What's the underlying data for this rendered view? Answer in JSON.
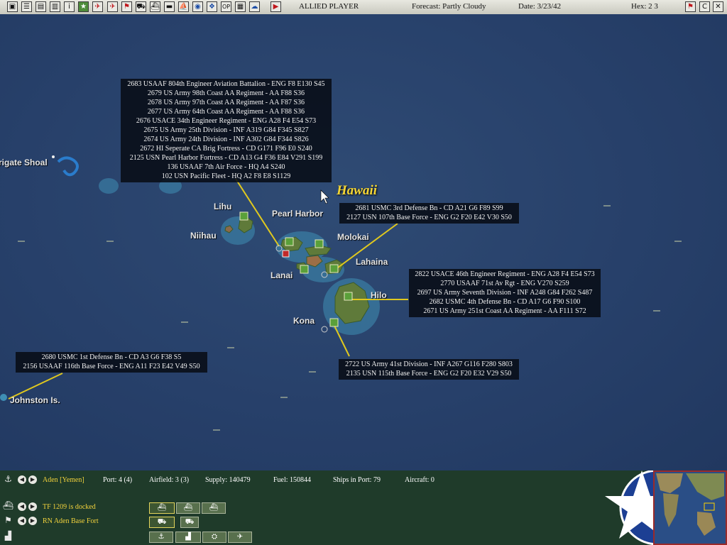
{
  "toolbar": {
    "icons": [
      {
        "name": "save-icon",
        "glyph": "▣"
      },
      {
        "name": "list-icon",
        "glyph": "☰"
      },
      {
        "name": "report-icon",
        "glyph": "▤"
      },
      {
        "name": "filter-icon",
        "glyph": "▥"
      },
      {
        "name": "info-icon",
        "glyph": "i"
      },
      {
        "name": "airfield-toggle-icon",
        "glyph": "★"
      },
      {
        "name": "aircraft-icon",
        "glyph": "✈"
      },
      {
        "name": "naval-aircraft-icon",
        "glyph": "✈"
      },
      {
        "name": "flag-icon",
        "glyph": "⚑"
      },
      {
        "name": "ground-units-icon",
        "glyph": "⛟"
      },
      {
        "name": "ships-icon",
        "glyph": "⛴"
      },
      {
        "name": "sub-icon",
        "glyph": "▬"
      },
      {
        "name": "task-force-icon",
        "glyph": "⛵"
      },
      {
        "name": "globe-icon",
        "glyph": "◉"
      },
      {
        "name": "terrain-icon",
        "glyph": "❖"
      },
      {
        "name": "ops-button-icon",
        "glyph": "OP"
      },
      {
        "name": "screen-icon",
        "glyph": "▦"
      },
      {
        "name": "weather-icon",
        "glyph": "☁"
      },
      {
        "name": "end-turn-icon",
        "glyph": "▶"
      }
    ],
    "player": "ALLIED PLAYER",
    "forecast": "Forecast: Partly Cloudy",
    "date": "Date: 3/23/42",
    "hex": "Hex: 2 3",
    "right_icons": [
      {
        "name": "flag-right-icon",
        "glyph": "⚑"
      },
      {
        "name": "command-icon",
        "glyph": "C"
      },
      {
        "name": "close-icon",
        "glyph": "✕"
      }
    ]
  },
  "map": {
    "places": {
      "frigate_shoal": "rigate Shoal",
      "lihu": "Lihu",
      "pearl_harbor": "Pearl Harbor",
      "niihau": "Niihau",
      "molokai": "Molokai",
      "lahaina": "Lahaina",
      "lanai": "Lanai",
      "hilo": "Hilo",
      "kona": "Kona",
      "johnston": "Johnston Is.",
      "hawaii": "Hawaii"
    },
    "infoboxes": {
      "pearl": [
        "2683 USAAF 804th Engineer Aviation Battalion - ENG  F8  E130  S45",
        "2679 US Army 98th Coast AA Regiment - AA  F88  S36",
        "2678 US Army 97th Coast AA Regiment - AA  F87  S36",
        "2677 US Army 64th Coast AA Regiment - AA  F88  S36",
        "2676 USACE 34th Engineer Regiment - ENG  A28  F4  E54  S73",
        "2675 US Army 25th Division - INF  A319  G84  F345  S827",
        "2674 US Army 24th Division - INF  A302  G84  F344  S826",
        "2672 HI Seperate CA Brig Fortress - CD  G171  F96  E0  S240",
        "2125 USN Pearl Harbor Fortress - CD  A13  G4  F36  E84  V291  S199",
        "136 USAAF 7th Air Force - HQ  A4  S240",
        "102 USN Pacific Fleet - HQ  A2  F8  E8  S1129"
      ],
      "lahaina": [
        "2681 USMC 3rd Defense Bn - CD  A21  G6  F89  S99",
        "2127 USN 107th Base Force - ENG  G2  F20  E42  V30  S50"
      ],
      "hilo": [
        "2822 USACE 46th Engineer Regiment - ENG  A28  F4  E54  S73",
        "2770 USAAF 71st Av Rgt - ENG  V270  S259",
        "2697 US Army Seventh Division - INF  A248  G84  F262  S487",
        "2682 USMC 4th Defense Bn - CD  A17  G6  F90  S100",
        "2671 US Army 251st Coast AA Regiment - AA  F111  S72"
      ],
      "kona": [
        "2722 US Army 41st Division - INF  A267  G116  F280  S803",
        "2135 USN 115th Base Force - ENG  G2  F20  E32  V29  S50"
      ],
      "johnston": [
        "2680 USMC 1st Defense Bn - CD  A3  G6  F38  S5",
        "2156 USAAF 116th Base Force - ENG  A11  F23  E42  V49  S50"
      ]
    }
  },
  "bottom": {
    "base_name": "Aden [Yemen]",
    "port": "Port: 4 (4)",
    "airfield": "Airfield: 3 (3)",
    "supply": "Supply: 140479",
    "fuel": "Fuel: 150844",
    "ships_in_port": "Ships in Port: 79",
    "aircraft": "Aircraft: 0",
    "tf_status": "TF 1209 is docked",
    "base_fort": "RN Aden Base Fort"
  },
  "colors": {
    "accent": "#f2d23c",
    "map_ocean": "#27406a",
    "info_line": "#e0c81e",
    "panel": "#1f3b2a"
  }
}
